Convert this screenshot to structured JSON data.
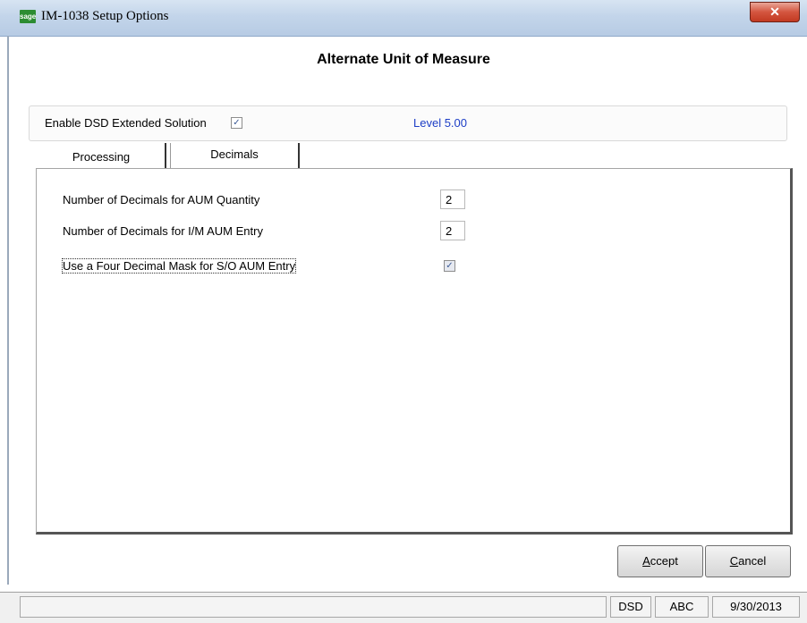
{
  "window": {
    "title": "IM-1038 Setup Options",
    "icon_text": "sage",
    "close_label": "✕"
  },
  "heading": "Alternate Unit of Measure",
  "enable": {
    "label": "Enable DSD Extended Solution",
    "checked": true,
    "level": "Level  5.00"
  },
  "tabs": [
    {
      "label": "Processing",
      "active": false
    },
    {
      "label": "Decimals",
      "active": true
    }
  ],
  "decimals": {
    "aum_quantity_label": "Number of Decimals for AUM Quantity",
    "aum_quantity_value": "2",
    "im_aum_entry_label": "Number of Decimals for I/M AUM Entry",
    "im_aum_entry_value": "2",
    "four_decimal_label": "Use a Four Decimal Mask for S/O AUM Entry",
    "four_decimal_checked": true
  },
  "buttons": {
    "accept_mnemonic": "A",
    "accept_rest": "ccept",
    "cancel_mnemonic": "C",
    "cancel_rest": "ancel"
  },
  "status": {
    "main": "",
    "module": "DSD",
    "company": "ABC",
    "date": "9/30/2013"
  }
}
